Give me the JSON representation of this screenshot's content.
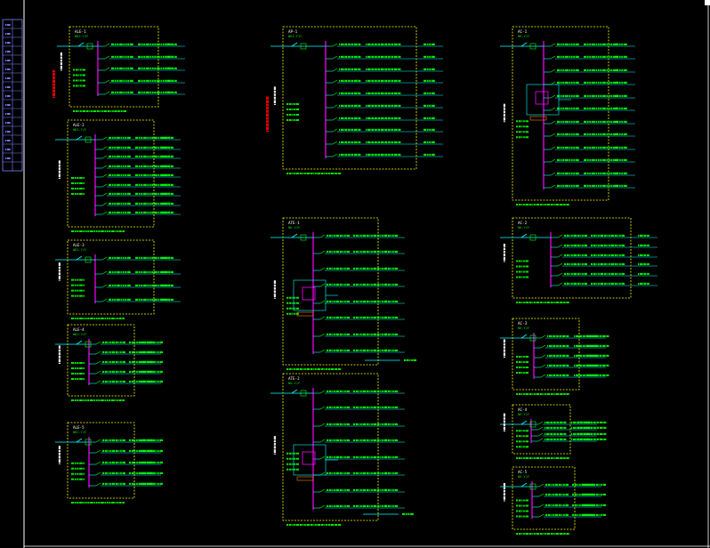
{
  "colors": {
    "background": "#000000",
    "frame": "#ffffff",
    "panel_border": "#ffff00",
    "busbar": "#ff00ff",
    "feeder": "#00ffff",
    "labels": "#00ff00",
    "warning_text": "#ff0000",
    "title_block": "#8080ff"
  },
  "title_block": {
    "rows": 17
  },
  "panels": [
    {
      "id": "AL1",
      "title": "ALE-1",
      "feeders": 5,
      "incoming_tag": "WDZ-YJY"
    },
    {
      "id": "AL2",
      "title": "ALE-2",
      "feeders": 9,
      "incoming_tag": "WDZ-YJY"
    },
    {
      "id": "AL3",
      "title": "ALE-3",
      "feeders": 4,
      "incoming_tag": "WDZ-YJY"
    },
    {
      "id": "AL4",
      "title": "ALE-4",
      "feeders": 5,
      "incoming_tag": "WDZ-YJY"
    },
    {
      "id": "AL5",
      "title": "ALE-5",
      "feeders": 5,
      "incoming_tag": "WDZ-YJY"
    },
    {
      "id": "AP1",
      "title": "AP-1",
      "feeders": 10,
      "incoming_tag": "WDZ-YJY"
    },
    {
      "id": "AT1",
      "title": "ATE-1",
      "feeders": 8,
      "incoming_tag": "NH-YJY"
    },
    {
      "id": "AT2",
      "title": "ATE-2",
      "feeders": 8,
      "incoming_tag": "NH-YJY"
    },
    {
      "id": "AC1",
      "title": "AC-1",
      "feeders": 12,
      "incoming_tag": "NH-YJY"
    },
    {
      "id": "AC2",
      "title": "AC-2",
      "feeders": 6,
      "incoming_tag": "NH-YJY"
    },
    {
      "id": "AC3",
      "title": "AC-3",
      "feeders": 5,
      "incoming_tag": "NH-YJY"
    },
    {
      "id": "AC4",
      "title": "AC-4",
      "feeders": 4,
      "incoming_tag": "NH-YJY"
    },
    {
      "id": "AC5",
      "title": "AC-5",
      "feeders": 4,
      "incoming_tag": "NH-YJY"
    }
  ]
}
